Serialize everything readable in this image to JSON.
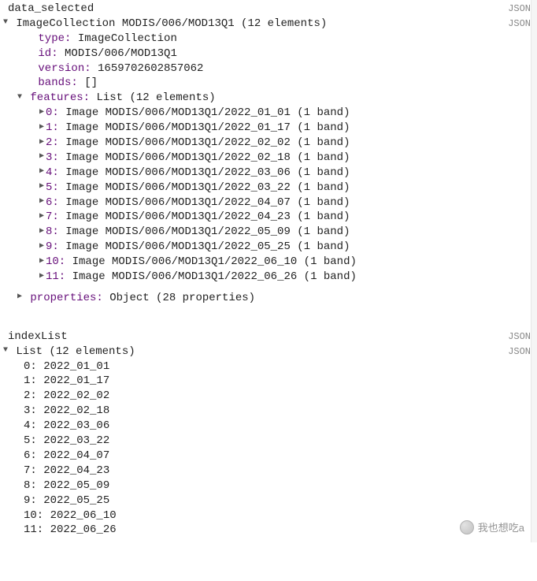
{
  "section1": {
    "title": "data_selected",
    "jsonLabel": "JSON",
    "root": {
      "label": "ImageCollection MODIS/006/MOD13Q1 (12 elements)",
      "jsonLabel": "JSON"
    },
    "type": {
      "key": "type:",
      "val": "ImageCollection"
    },
    "id": {
      "key": "id:",
      "val": "MODIS/006/MOD13Q1"
    },
    "version": {
      "key": "version:",
      "val": "1659702602857062"
    },
    "bands": {
      "key": "bands:",
      "val": "[]"
    },
    "features": {
      "key": "features:",
      "val": "List (12 elements)",
      "items": [
        {
          "idx": "0:",
          "val": "Image MODIS/006/MOD13Q1/2022_01_01 (1 band)"
        },
        {
          "idx": "1:",
          "val": "Image MODIS/006/MOD13Q1/2022_01_17 (1 band)"
        },
        {
          "idx": "2:",
          "val": "Image MODIS/006/MOD13Q1/2022_02_02 (1 band)"
        },
        {
          "idx": "3:",
          "val": "Image MODIS/006/MOD13Q1/2022_02_18 (1 band)"
        },
        {
          "idx": "4:",
          "val": "Image MODIS/006/MOD13Q1/2022_03_06 (1 band)"
        },
        {
          "idx": "5:",
          "val": "Image MODIS/006/MOD13Q1/2022_03_22 (1 band)"
        },
        {
          "idx": "6:",
          "val": "Image MODIS/006/MOD13Q1/2022_04_07 (1 band)"
        },
        {
          "idx": "7:",
          "val": "Image MODIS/006/MOD13Q1/2022_04_23 (1 band)"
        },
        {
          "idx": "8:",
          "val": "Image MODIS/006/MOD13Q1/2022_05_09 (1 band)"
        },
        {
          "idx": "9:",
          "val": "Image MODIS/006/MOD13Q1/2022_05_25 (1 band)"
        },
        {
          "idx": "10:",
          "val": "Image MODIS/006/MOD13Q1/2022_06_10 (1 band)"
        },
        {
          "idx": "11:",
          "val": "Image MODIS/006/MOD13Q1/2022_06_26 (1 band)"
        }
      ]
    },
    "properties": {
      "key": "properties:",
      "val": "Object (28 properties)"
    }
  },
  "section2": {
    "title": "indexList",
    "jsonLabel": "JSON",
    "root": {
      "label": "List (12 elements)",
      "jsonLabel": "JSON"
    },
    "items": [
      {
        "idx": "0:",
        "val": "2022_01_01"
      },
      {
        "idx": "1:",
        "val": "2022_01_17"
      },
      {
        "idx": "2:",
        "val": "2022_02_02"
      },
      {
        "idx": "3:",
        "val": "2022_02_18"
      },
      {
        "idx": "4:",
        "val": "2022_03_06"
      },
      {
        "idx": "5:",
        "val": "2022_03_22"
      },
      {
        "idx": "6:",
        "val": "2022_04_07"
      },
      {
        "idx": "7:",
        "val": "2022_04_23"
      },
      {
        "idx": "8:",
        "val": "2022_05_09"
      },
      {
        "idx": "9:",
        "val": "2022_05_25"
      },
      {
        "idx": "10:",
        "val": "2022_06_10"
      },
      {
        "idx": "11:",
        "val": "2022_06_26"
      }
    ]
  },
  "watermark": "我也想吃a",
  "caret": {
    "down": "▼",
    "right": "▶"
  }
}
